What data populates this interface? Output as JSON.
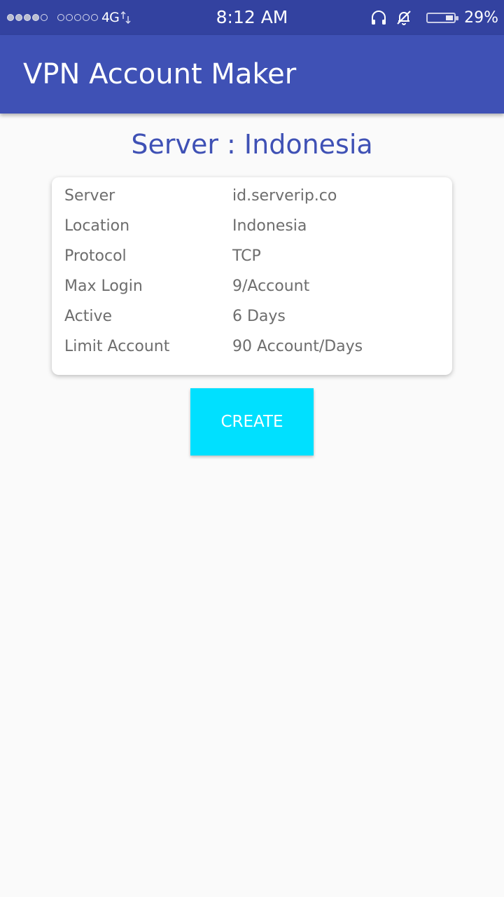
{
  "status_bar": {
    "network": "4G",
    "time": "8:12 AM",
    "battery": "29%",
    "icons": [
      "signal-icon",
      "data-activity-icon",
      "headphones-icon",
      "bell-off-icon",
      "battery-icon"
    ]
  },
  "app_bar": {
    "title": "VPN Account Maker",
    "color": "#3f51b5"
  },
  "server_heading": "Server : Indonesia",
  "details": {
    "server": {
      "label": "Server",
      "value": "id.serverip.co"
    },
    "location": {
      "label": "Location",
      "value": "Indonesia"
    },
    "protocol": {
      "label": "Protocol",
      "value": "TCP"
    },
    "max_login": {
      "label": "Max Login",
      "value": "9/Account"
    },
    "active": {
      "label": "Active",
      "value": "6 Days"
    },
    "limit": {
      "label": "Limit Account",
      "value": "90 Account/Days"
    }
  },
  "create_button": {
    "label": "CREATE",
    "color": "#00e0ff"
  }
}
